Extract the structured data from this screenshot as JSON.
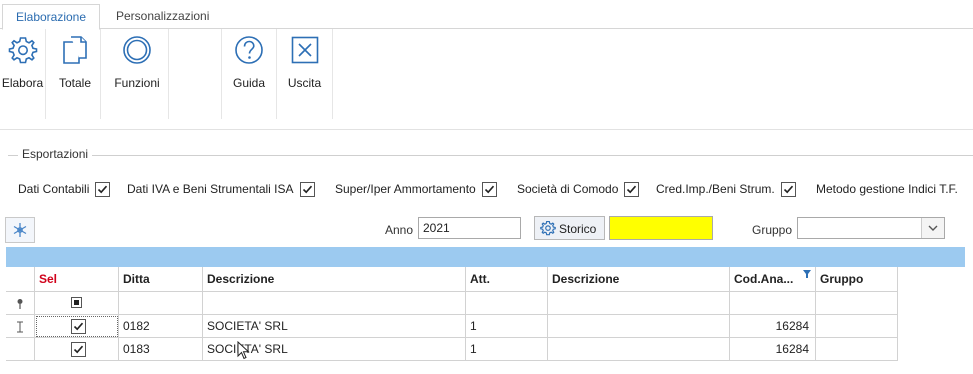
{
  "tabs": [
    {
      "label": "Elaborazione"
    },
    {
      "label": "Personalizzazioni"
    }
  ],
  "ribbon": [
    {
      "label": "Elabora",
      "icon": "gear-icon"
    },
    {
      "label": "Totale",
      "icon": "copy-icon"
    },
    {
      "label": "Funzioni",
      "icon": "circle-icon"
    },
    {
      "label": "Guida",
      "icon": "help-icon"
    },
    {
      "label": "Uscita",
      "icon": "close-icon"
    }
  ],
  "exports": {
    "title": "Esportazioni",
    "options": [
      {
        "label": "Dati Contabili",
        "checked": true
      },
      {
        "label": "Dati IVA e Beni Strumentali ISA",
        "checked": true
      },
      {
        "label": "Super/Iper Ammortamento",
        "checked": true
      },
      {
        "label": "Società di Comodo",
        "checked": true
      },
      {
        "label": "Cred.Imp./Beni Strum.",
        "checked": true
      },
      {
        "label": "Metodo gestione Indici T.F.",
        "checked": false
      }
    ]
  },
  "filters": {
    "anno_label": "Anno",
    "anno_value": "2021",
    "storico_label": "Storico",
    "gruppo_label": "Gruppo",
    "gruppo_value": "",
    "highlight_color": "#ffff00"
  },
  "grid": {
    "columns": [
      {
        "label": "Sel",
        "color": "#d0021b"
      },
      {
        "label": "Ditta"
      },
      {
        "label": "Descrizione"
      },
      {
        "label": "Att."
      },
      {
        "label": "Descrizione"
      },
      {
        "label": "Cod.Ana..."
      },
      {
        "label": "Gruppo"
      }
    ],
    "rows": [
      {
        "sel": true,
        "ditta": "0182",
        "descrizione": "SOCIETA' SRL",
        "att": "1",
        "descrizione2": "",
        "cod": "16284",
        "gruppo": ""
      },
      {
        "sel": true,
        "ditta": "0183",
        "descrizione": "SOCIETA' SRL",
        "att": "1",
        "descrizione2": "",
        "cod": "16284",
        "gruppo": ""
      }
    ]
  }
}
